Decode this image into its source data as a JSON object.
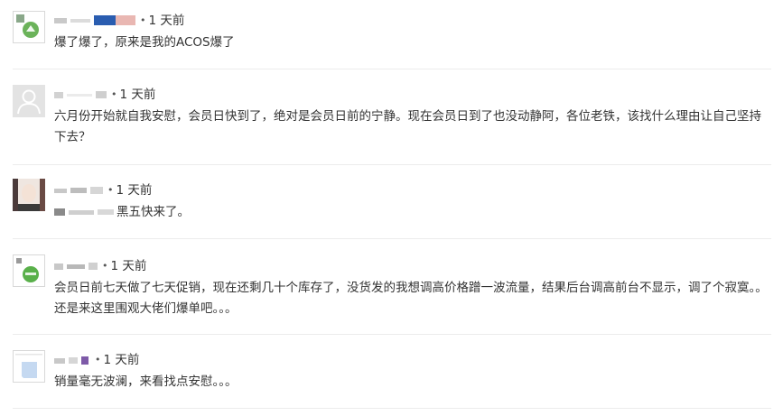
{
  "comments": [
    {
      "time": "1 天前",
      "separator": "•",
      "text": "爆了爆了，原来是我的ACOS爆了"
    },
    {
      "time": "1 天前",
      "separator": "•",
      "text": "六月份开始就自我安慰，会员日快到了，绝对是会员日前的宁静。现在会员日到了也没动静阿，各位老铁，该找什么理由让自己坚持下去？"
    },
    {
      "time": "1 天前",
      "separator": "•",
      "text": "黑五快来了。"
    },
    {
      "time": "1 天前",
      "separator": "•",
      "text": "会员日前七天做了七天促销，现在还剩几十个库存了，没货发的我想调高价格蹭一波流量，结果后台调高前台不显示，调了个寂寞。。还是来这里围观大佬们爆单吧。。。"
    },
    {
      "time": "1 天前",
      "separator": "•",
      "text": "销量毫无波澜，来看找点安慰。。。"
    }
  ],
  "icons": {
    "avatar_1": "green-leaf-avatar",
    "avatar_2": "default-user-silhouette-icon",
    "avatar_3": "photo-avatar",
    "avatar_4": "green-circle-avatar",
    "avatar_5": "blue-document-avatar"
  },
  "colors": {
    "text": "#333333",
    "divider": "#ececec",
    "default_avatar_bg": "#e3e3e3"
  }
}
